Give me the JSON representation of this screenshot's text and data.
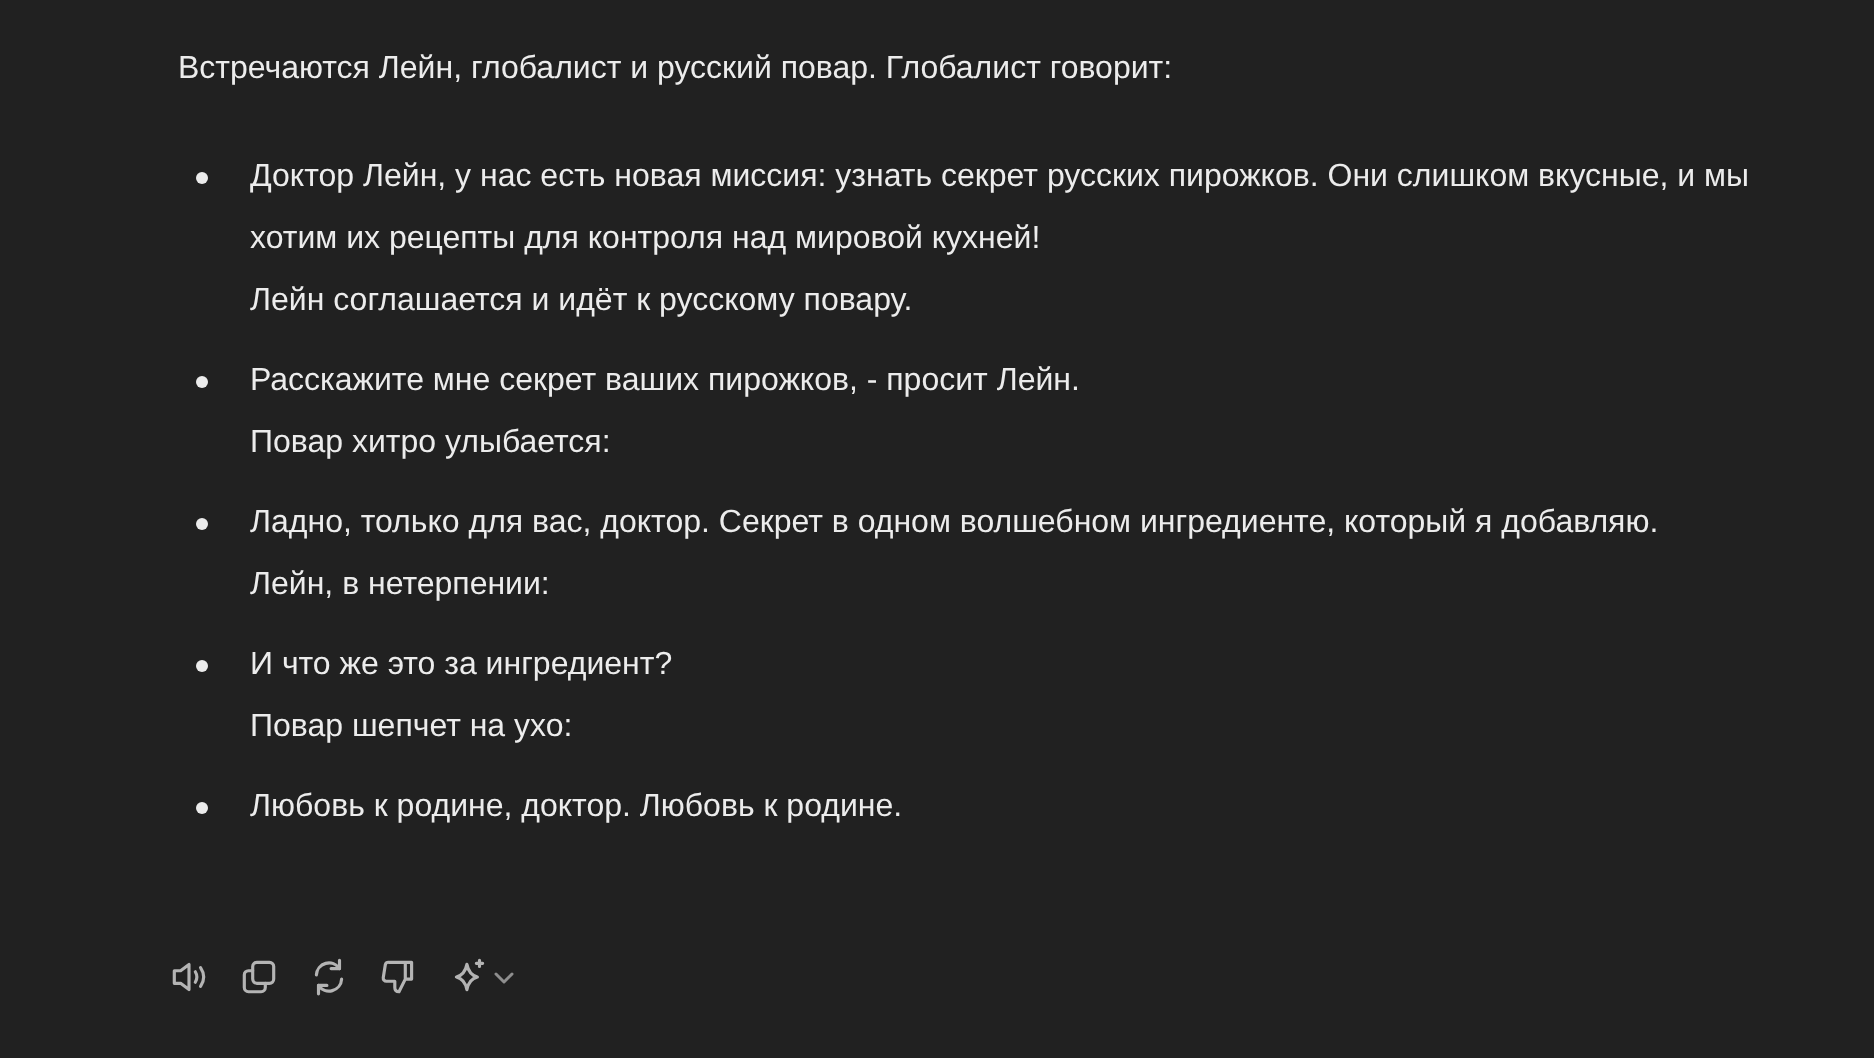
{
  "message": {
    "intro": "Встречаются Лейн, глобалист и русский повар. Глобалист говорит:",
    "items": [
      {
        "text": "Доктор Лейн, у нас есть новая миссия: узнать секрет русских пирожков. Они слишком вкусные, и мы хотим их рецепты для контроля над мировой кухней!",
        "note": "Лейн соглашается и идёт к русскому повару."
      },
      {
        "text": "Расскажите мне секрет ваших пирожков, - просит Лейн.",
        "note": "Повар хитро улыбается:"
      },
      {
        "text": "Ладно, только для вас, доктор. Секрет в одном волшебном ингредиенте, который я добавляю.",
        "note": "Лейн, в нетерпении:"
      },
      {
        "text": "И что же это за ингредиент?",
        "note": "Повар шепчет на ухо:"
      },
      {
        "text": "Любовь к родине, доктор. Любовь к родине."
      }
    ]
  },
  "actions": [
    {
      "kind": "speaker"
    },
    {
      "kind": "copy"
    },
    {
      "kind": "regenerate"
    },
    {
      "kind": "dislike"
    },
    {
      "kind": "sparkle"
    }
  ]
}
